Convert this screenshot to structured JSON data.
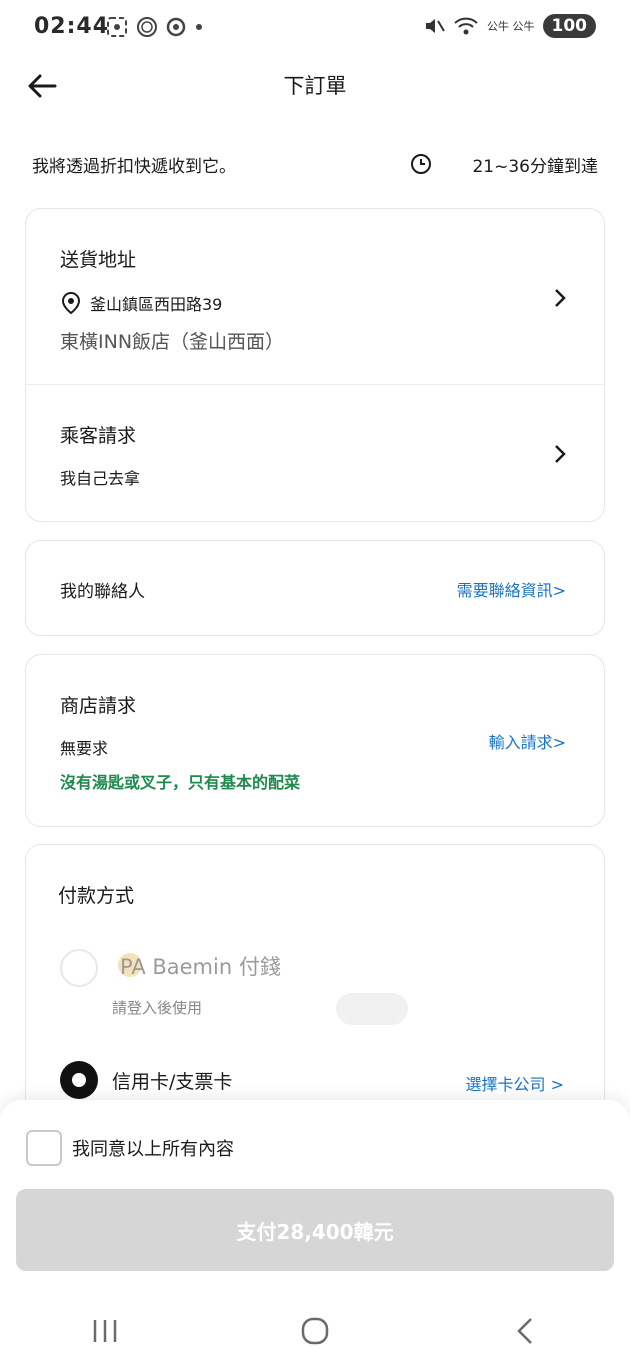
{
  "status": {
    "time": "02:44",
    "network": "公牛 公牛",
    "battery": "100"
  },
  "header": {
    "title": "下訂單"
  },
  "delivery": {
    "text": "我將透過折扣快遞收到它。",
    "eta": "21~36分鐘到達"
  },
  "address": {
    "title": "送貨地址",
    "street": "釜山鎮區西田路39",
    "place": "東橫INN飯店（釜山西面）"
  },
  "rider": {
    "title": "乘客請求",
    "value": "我自己去拿"
  },
  "contact": {
    "title": "我的聯絡人",
    "link": "需要聯絡資訊>"
  },
  "store": {
    "title": "商店請求",
    "request": "無要求",
    "link": "輸入請求>",
    "note": "沒有湯匙或叉子，只有基本的配菜"
  },
  "payment": {
    "title": "付款方式",
    "option1_label": "PA Baemin 付錢",
    "option1_sub": "請登入後使用",
    "option2_label": "信用卡/支票卡",
    "option2_link": "選擇卡公司 >"
  },
  "agree": {
    "label": "我同意以上所有內容"
  },
  "pay_button": {
    "label": "支付28,400韓元"
  },
  "colors": {
    "accent_blue": "#1a73c8",
    "note_green": "#1e8a4e",
    "button_disabled": "#d6d6d6"
  }
}
